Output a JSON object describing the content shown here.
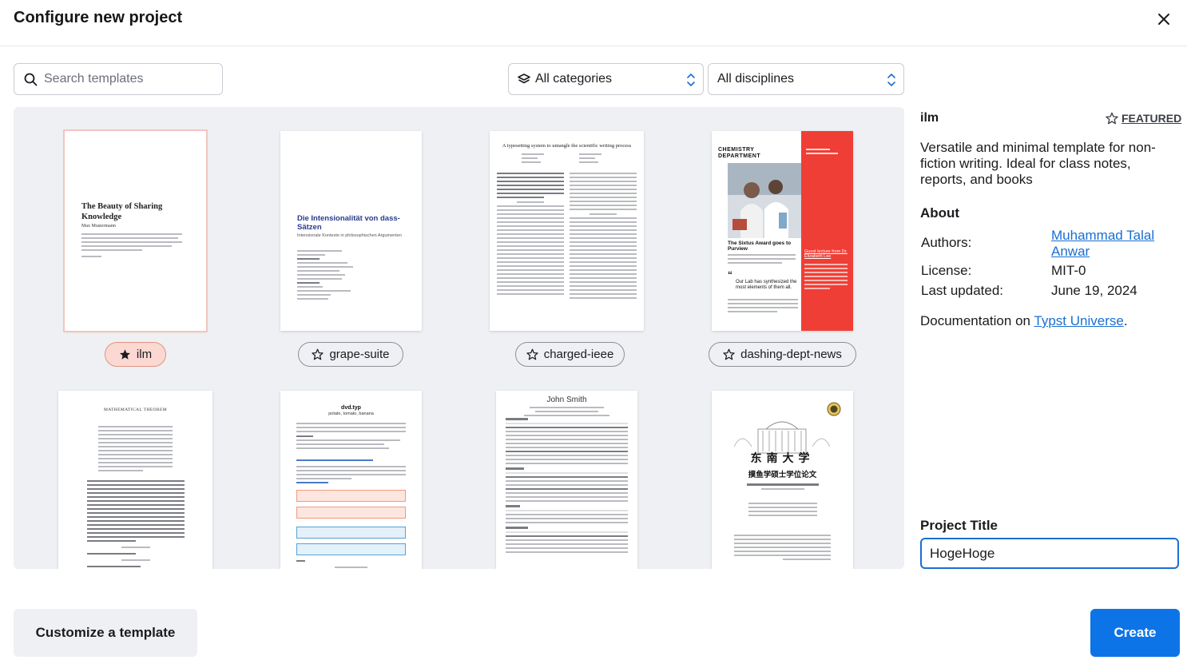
{
  "dialog": {
    "title": "Configure new project"
  },
  "search": {
    "placeholder": "Search templates"
  },
  "filters": {
    "category": "All categories",
    "discipline": "All disciplines"
  },
  "templates": [
    {
      "name": "ilm",
      "starred": true,
      "selected": true,
      "preview_title": "The Beauty of Sharing Knowledge",
      "preview_author": "Max Mustermann"
    },
    {
      "name": "grape-suite",
      "starred": false,
      "preview_title": "Die Intensionalität von dass-Sätzen",
      "preview_subtitle": "Intensionale Kontexte in philosophischen Argumenten"
    },
    {
      "name": "charged-ieee",
      "starred": false,
      "preview_title": "A typesetting system to untangle the scientific writing process"
    },
    {
      "name": "dashing-dept-news",
      "starred": false,
      "preview_title": "CHEMISTRY DEPARTMENT",
      "preview_story": "The Sixtus Award goes to Purview",
      "preview_quote": "Our Lab has synthesized the most elements of them all.",
      "preview_sidebar": "Guest lecture from Dr. Elizabeth Lee"
    },
    {
      "name": "",
      "preview_title": "MATHEMATICAL THEOREM"
    },
    {
      "name": "",
      "preview_title": "dvd.typ",
      "preview_subtitle": "potato, tomato, banana"
    },
    {
      "name": "",
      "preview_title": "John Smith"
    },
    {
      "name": "",
      "preview_title": "东南大学",
      "preview_subtitle": "摸鱼学硕士学位论文"
    }
  ],
  "details": {
    "name": "ilm",
    "featured_label": "FEATURED",
    "description": "Versatile and minimal template for non-fiction writing. Ideal for class notes, reports, and books",
    "about_heading": "About",
    "authors_label": "Authors:",
    "authors_value": "Muhammad Talal Anwar",
    "license_label": "License:",
    "license_value": "MIT-0",
    "updated_label": "Last updated:",
    "updated_value": "June 19, 2024",
    "docs_prefix": "Documentation on ",
    "docs_link": "Typst Universe",
    "docs_suffix": "."
  },
  "project": {
    "label": "Project Title",
    "value": "HogeHoge"
  },
  "buttons": {
    "customize": "Customize a template",
    "create": "Create"
  },
  "colors": {
    "accent": "#0d74e7",
    "selected_chip": "#fbd9d2",
    "dept_red": "#ef3e36"
  }
}
